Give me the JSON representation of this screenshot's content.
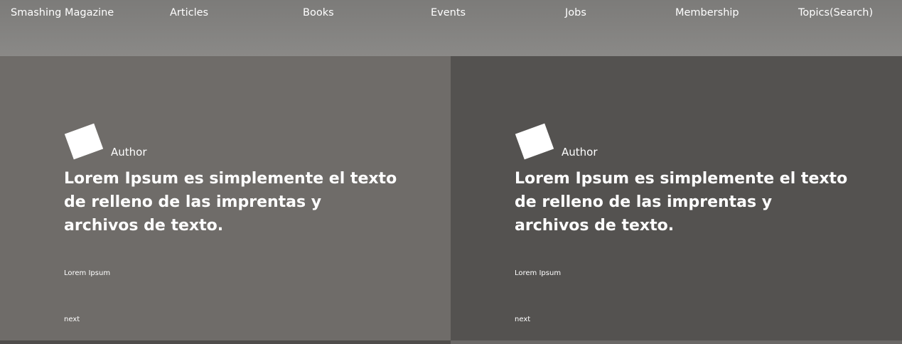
{
  "nav": {
    "brand": "Smashing Magazine",
    "items": [
      "Articles",
      "Books",
      "Events",
      "Jobs",
      "Membership",
      "Topics(Search)"
    ]
  },
  "panels": [
    {
      "author": "Author",
      "headline": "Lorem Ipsum es simplemente el texto de relleno de las imprentas y archivos de texto.",
      "meta": "Lorem Ipsum",
      "next": "next",
      "bg_color": "#6f6c69"
    },
    {
      "author": "Author",
      "headline": "Lorem Ipsum es simplemente el texto de relleno de las imprentas y archivos de texto.",
      "meta": "Lorem Ipsum",
      "next": "next",
      "bg_color": "#545250"
    }
  ],
  "colors": {
    "nav_bg": "#858482",
    "text": "#ffffff"
  },
  "icons": {
    "logo": "rotated-square-logo-icon"
  }
}
